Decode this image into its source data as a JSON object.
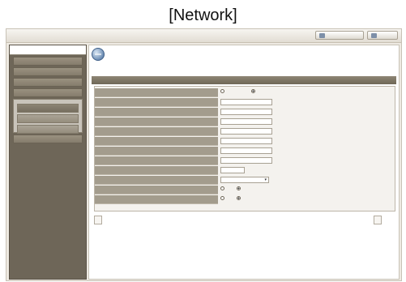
{
  "caption": "[Network]",
  "topbar": {
    "webviewer_label": "",
    "logout_label": ""
  },
  "sidebar": {
    "heading": "",
    "items": [
      {
        "label": ""
      },
      {
        "label": ""
      },
      {
        "label": ""
      },
      {
        "label": ""
      }
    ],
    "submenu": [
      {
        "label": ""
      },
      {
        "label": ""
      },
      {
        "label": ""
      }
    ],
    "bottom_item": ""
  },
  "main": {
    "title": "",
    "section_title": "",
    "rows": [
      {
        "label": "",
        "options": [
          "",
          ""
        ],
        "selected": 1
      },
      {
        "label": "",
        "value": ""
      },
      {
        "label": "",
        "value": ""
      },
      {
        "label": "",
        "value": ""
      },
      {
        "label": "",
        "value": ""
      },
      {
        "label": "",
        "value": ""
      },
      {
        "label": "",
        "value": ""
      },
      {
        "label": "",
        "value": ""
      },
      {
        "label": "",
        "value": ""
      },
      {
        "label": "",
        "selected": ""
      },
      {
        "label": "",
        "options": [
          "",
          ""
        ],
        "selected": 1
      },
      {
        "label": "",
        "options": [
          "",
          ""
        ],
        "selected": 1
      }
    ],
    "refresh_label": "",
    "save_label": ""
  }
}
